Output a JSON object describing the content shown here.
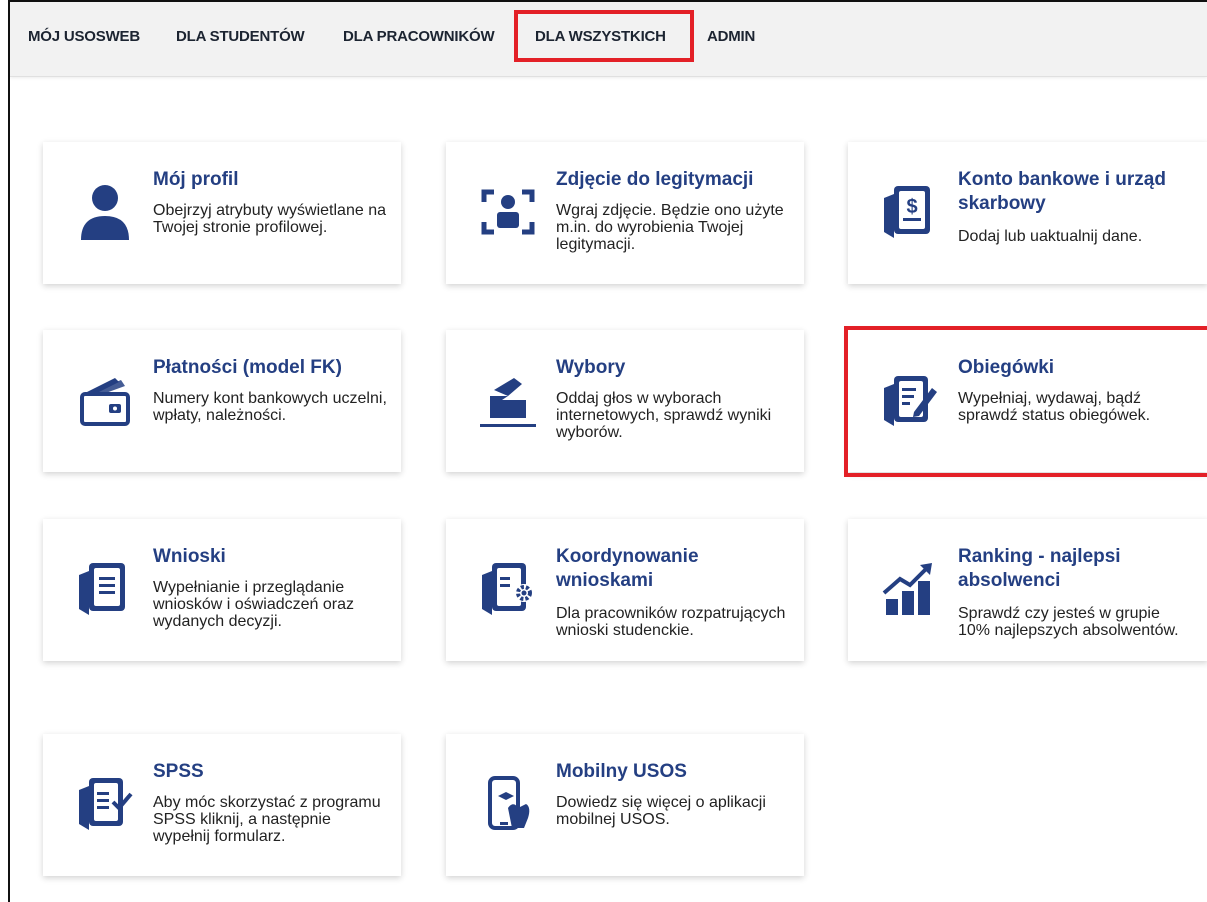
{
  "nav": {
    "items": [
      {
        "label": "MÓJ USOSWEB"
      },
      {
        "label": "DLA STUDENTÓW"
      },
      {
        "label": "DLA PRACOWNIKÓW"
      },
      {
        "label": "DLA WSZYSTKICH",
        "highlighted": true
      },
      {
        "label": "ADMIN"
      }
    ]
  },
  "tiles": [
    {
      "title": "Mój profil",
      "desc": "Obejrzyj atrybuty wyświetlane na Twojej stronie profilowej.",
      "icon": "user-icon"
    },
    {
      "title": "Zdjęcie do legitymacji",
      "desc": "Wgraj zdjęcie. Będzie ono użyte m.in. do wyrobienia Twojej legitymacji.",
      "icon": "photo-frame-icon"
    },
    {
      "title": "Konto bankowe i urząd skarbowy",
      "desc": "Dodaj lub uaktualnij dane.",
      "icon": "dollar-document-icon"
    },
    {
      "title": "Płatności (model FK)",
      "desc": "Numery kont bankowych uczelni, wpłaty, należności.",
      "icon": "wallet-icon"
    },
    {
      "title": "Wybory",
      "desc": "Oddaj głos w wyborach internetowych, sprawdź wyniki wyborów.",
      "icon": "ballot-box-icon"
    },
    {
      "title": "Obiegówki",
      "desc": "Wypełniaj, wydawaj, bądź sprawdź status obiegówek.",
      "icon": "document-edit-icon",
      "highlighted": true
    },
    {
      "title": "Wnioski",
      "desc": "Wypełnianie i przeglądanie wniosków i oświadczeń oraz wydanych decyzji.",
      "icon": "documents-icon"
    },
    {
      "title": "Koordynowanie wnioskami",
      "desc": "Dla pracowników rozpatrujących wnioski studenckie.",
      "icon": "document-gear-icon"
    },
    {
      "title": "Ranking - najlepsi absolwenci",
      "desc": "Sprawdź czy jesteś w grupie 10% najlepszych absolwentów.",
      "icon": "ranking-chart-icon"
    },
    {
      "title": "SPSS",
      "desc": "Aby móc skorzystać z programu SPSS kliknij, a następnie wypełnij formularz.",
      "icon": "document-check-icon"
    },
    {
      "title": "Mobilny USOS",
      "desc": "Dowiedz się więcej o aplikacji mobilnej USOS.",
      "icon": "mobile-phone-icon"
    }
  ],
  "colors": {
    "accent": "#243f82",
    "highlight": "#e32027",
    "nav_bg": "#f2f2f2"
  }
}
